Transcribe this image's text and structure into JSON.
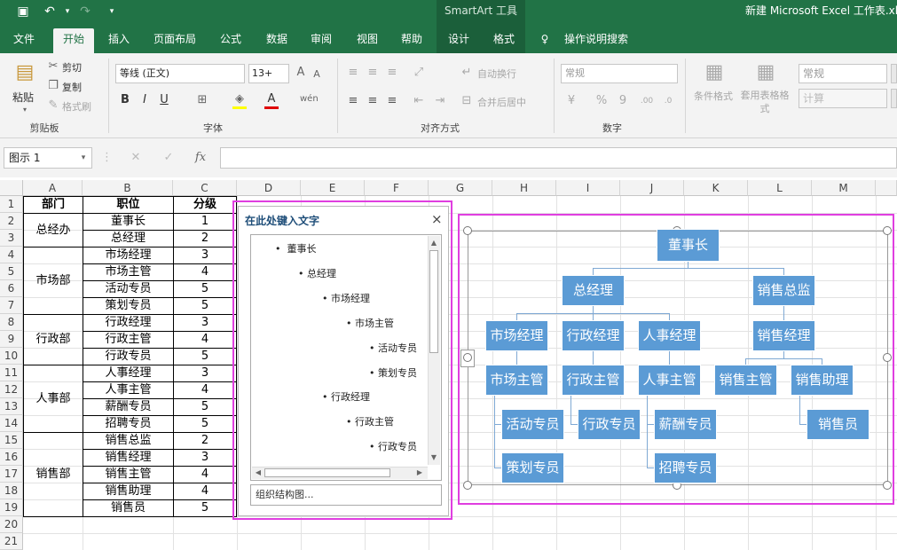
{
  "title_bar": {
    "context_tool": "SmartArt 工具",
    "document_title": "新建 Microsoft Excel 工作表.xl"
  },
  "tabs": [
    "文件",
    "开始",
    "插入",
    "页面布局",
    "公式",
    "数据",
    "审阅",
    "视图",
    "帮助",
    "设计",
    "格式"
  ],
  "tell_me": "操作说明搜索",
  "ribbon": {
    "clipboard": {
      "paste": "粘贴",
      "cut": "剪切",
      "copy": "复制",
      "format_painter": "格式刷",
      "label": "剪贴板"
    },
    "font": {
      "name": "等线 (正文)",
      "size": "13+",
      "bold": "B",
      "italic": "I",
      "underline": "U",
      "label": "字体"
    },
    "alignment": {
      "wrap": "自动换行",
      "merge": "合并后居中",
      "label": "对齐方式"
    },
    "number": {
      "format": "常规",
      "label": "数字"
    },
    "styles": {
      "conditional": "条件格式",
      "table": "套用表格格式",
      "style1": "常规",
      "style2": "计算"
    }
  },
  "formula_bar": {
    "name_box": "图示 1",
    "fx": "fx"
  },
  "columns": [
    "A",
    "B",
    "C",
    "D",
    "E",
    "F",
    "G",
    "H",
    "I",
    "J",
    "K",
    "L",
    "M"
  ],
  "rows": [
    "1",
    "2",
    "3",
    "4",
    "5",
    "6",
    "7",
    "8",
    "9",
    "10",
    "11",
    "12",
    "13",
    "14",
    "15",
    "16",
    "17",
    "18",
    "19",
    "20",
    "21"
  ],
  "table": {
    "headers": [
      "部门",
      "职位",
      "分级"
    ],
    "departments": [
      "总经办",
      "市场部",
      "行政部",
      "人事部",
      "销售部"
    ],
    "positions": [
      "董事长",
      "总经理",
      "市场经理",
      "市场主管",
      "活动专员",
      "策划专员",
      "行政经理",
      "行政主管",
      "行政专员",
      "人事经理",
      "人事主管",
      "薪酬专员",
      "招聘专员",
      "销售总监",
      "销售经理",
      "销售主管",
      "销售助理",
      "销售员"
    ],
    "levels": [
      "1",
      "2",
      "3",
      "4",
      "5",
      "5",
      "3",
      "4",
      "5",
      "3",
      "4",
      "5",
      "5",
      "2",
      "3",
      "4",
      "4",
      "5"
    ]
  },
  "text_pane": {
    "title": "在此处键入文字",
    "close": "×",
    "items": [
      "董事长",
      "总经理",
      "市场经理",
      "市场主管",
      "活动专员",
      "策划专员",
      "行政经理",
      "行政主管",
      "行政专员"
    ],
    "footer": "组织结构图..."
  },
  "smartart": {
    "nodes": [
      "董事长",
      "总经理",
      "销售总监",
      "市场经理",
      "行政经理",
      "人事经理",
      "销售经理",
      "市场主管",
      "行政主管",
      "人事主管",
      "销售主管",
      "销售助理",
      "活动专员",
      "行政专员",
      "薪酬专员",
      "销售员",
      "策划专员",
      "招聘专员"
    ]
  },
  "colors": {
    "excel_green": "#217346",
    "node_blue": "#5b9bd5",
    "highlight": "#e03ee0"
  }
}
